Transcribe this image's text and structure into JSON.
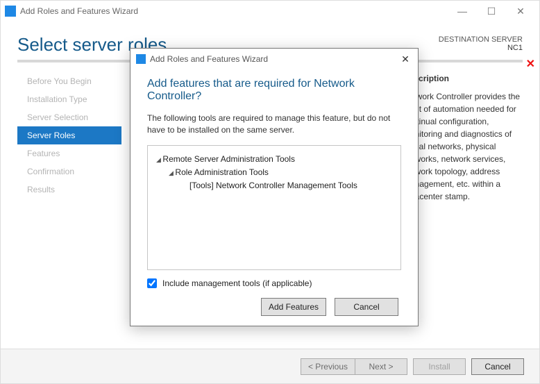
{
  "window": {
    "title": "Add Roles and Features Wizard",
    "minimize": "—",
    "maximize": "☐",
    "close": "✕"
  },
  "page_title": "Select server roles",
  "destination": {
    "label": "DESTINATION SERVER",
    "value": "NC1"
  },
  "red_x": "✕",
  "nav": {
    "items": [
      {
        "label": "Before You Begin"
      },
      {
        "label": "Installation Type"
      },
      {
        "label": "Server Selection"
      },
      {
        "label": "Server Roles"
      },
      {
        "label": "Features"
      },
      {
        "label": "Confirmation"
      },
      {
        "label": "Results"
      }
    ],
    "active_index": 3
  },
  "description": {
    "heading": "Description",
    "text_fragment": "Network Controller provides the point of automation needed for continual configuration, monitoring and diagnostics of virtual networks, physical networks, network services, network topology, address management, etc. within a datacenter stamp."
  },
  "footer": {
    "previous": "< Previous",
    "next": "Next >",
    "install": "Install",
    "cancel": "Cancel"
  },
  "modal": {
    "title": "Add Roles and Features Wizard",
    "heading": "Add features that are required for Network Controller?",
    "text": "The following tools are required to manage this feature, but do not have to be installed on the same server.",
    "tree": {
      "l1": "Remote Server Administration Tools",
      "l2": "Role Administration Tools",
      "l3": "[Tools] Network Controller Management Tools"
    },
    "include_label": "Include management tools (if applicable)",
    "include_checked": true,
    "add_features": "Add Features",
    "cancel": "Cancel",
    "close": "✕"
  }
}
